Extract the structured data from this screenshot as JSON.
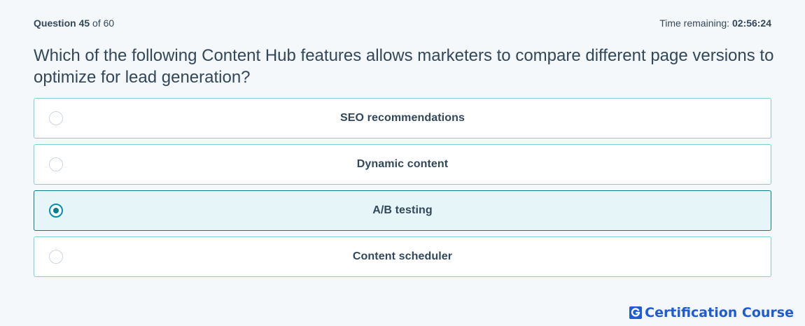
{
  "header": {
    "question_label": "Question",
    "question_number": "45",
    "question_of": "of 60",
    "time_label": "Time remaining:",
    "time_value": "02:56:24"
  },
  "question": {
    "text": "Which of the following Content Hub features allows marketers to compare different page versions to optimize for lead generation?"
  },
  "options": [
    {
      "label": "SEO recommendations",
      "selected": false
    },
    {
      "label": "Dynamic content",
      "selected": false
    },
    {
      "label": "A/B testing",
      "selected": true
    },
    {
      "label": "Content scheduler",
      "selected": false
    }
  ],
  "brand": {
    "name": "Certification Course",
    "icon": "g-logo-icon"
  },
  "colors": {
    "text": "#33475b",
    "option_border": "#7fd1de",
    "selected_bg": "#e5f5f8",
    "selected_border": "#0b7c8c",
    "brand": "#1f5bd8"
  }
}
